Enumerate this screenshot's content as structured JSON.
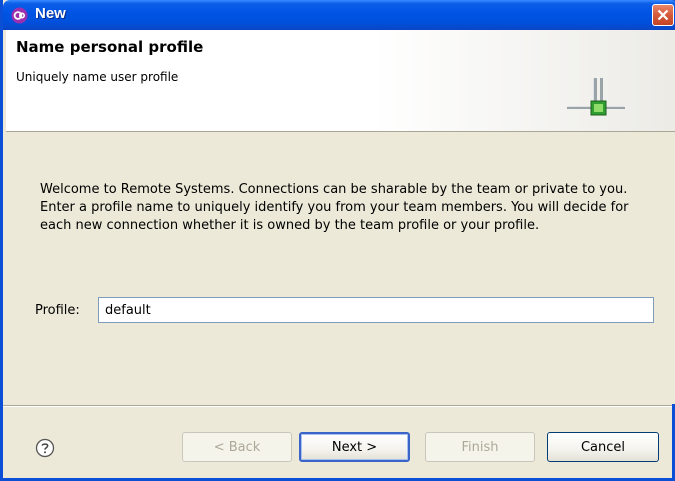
{
  "window": {
    "title": "New"
  },
  "banner": {
    "title": "Name personal profile",
    "subtitle": "Uniquely name user profile"
  },
  "content": {
    "description": "Welcome to Remote Systems. Connections can be sharable by the team or private to you. Enter a profile name to uniquely identify you from your team members. You will decide for each new connection whether it is owned by the team profile or your profile.",
    "profile_label": "Profile:",
    "profile_value": "default"
  },
  "buttons": {
    "back": "< Back",
    "next": "Next >",
    "finish": "Finish",
    "cancel": "Cancel"
  },
  "icons": {
    "app": "eclipse-app-icon",
    "close": "close-icon",
    "banner": "connection-wizard-icon",
    "help": "help-icon"
  },
  "colors": {
    "titlebar": "#0054e3",
    "close_button": "#d55a3b",
    "dialog_background": "#ece9d8",
    "banner_background": "#ffffff",
    "input_border": "#7f9db9"
  }
}
